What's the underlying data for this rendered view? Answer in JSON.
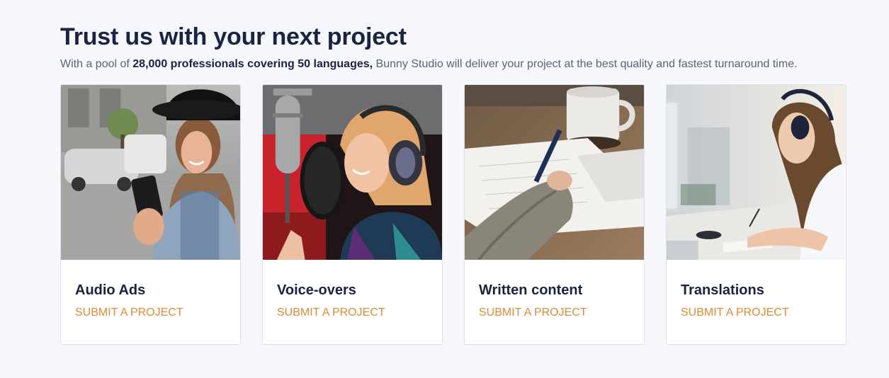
{
  "header": {
    "title": "Trust us with your next project",
    "subtitle_prefix": "With a pool of ",
    "subtitle_bold": "28,000 professionals covering 50 languages,",
    "subtitle_suffix": " Bunny Studio will deliver your project at the best quality and fastest turnaround time."
  },
  "cards": [
    {
      "title": "Audio Ads",
      "link": "SUBMIT A PROJECT",
      "image": "woman-with-phone-photo"
    },
    {
      "title": "Voice-overs",
      "link": "SUBMIT A PROJECT",
      "image": "woman-singing-microphone-photo"
    },
    {
      "title": "Written content",
      "link": "SUBMIT A PROJECT",
      "image": "hand-writing-notes-photo"
    },
    {
      "title": "Translations",
      "link": "SUBMIT A PROJECT",
      "image": "woman-headphones-desk-photo"
    }
  ],
  "colors": {
    "background": "#f5f7fd",
    "heading": "#1a2340",
    "accent": "#e08a33"
  }
}
